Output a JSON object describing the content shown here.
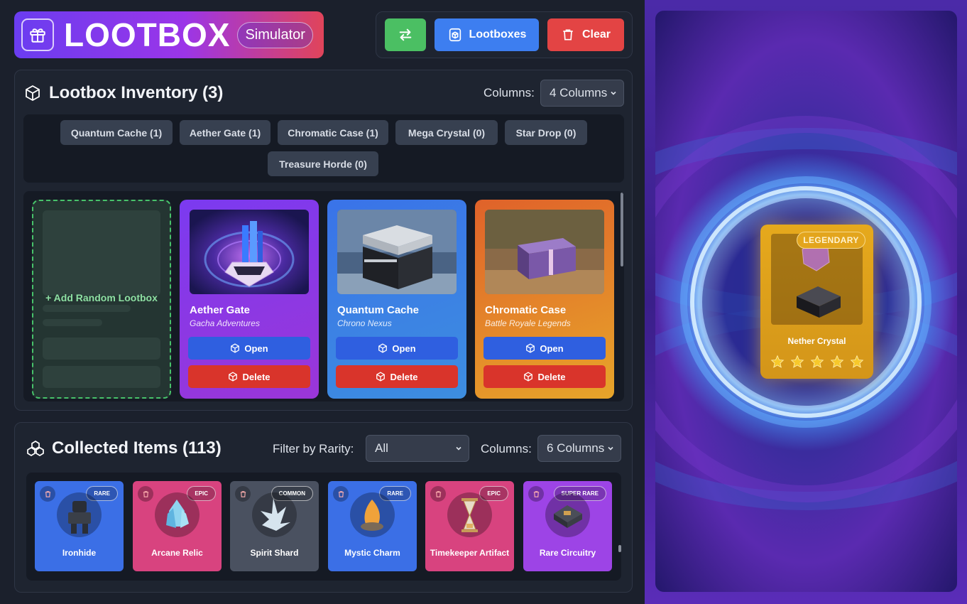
{
  "brand": {
    "title": "LOOTBOX",
    "badge": "Simulator"
  },
  "toolbar": {
    "lootboxes_label": "Lootboxes",
    "clear_label": "Clear"
  },
  "inventory": {
    "title": "Lootbox Inventory (3)",
    "columns_label": "Columns:",
    "columns_value": "4 Columns",
    "chips": [
      "Quantum Cache (1)",
      "Aether Gate (1)",
      "Chromatic Case (1)",
      "Mega Crystal (0)",
      "Star Drop (0)",
      "Treasure Horde (0)"
    ],
    "add_label": "+ Add Random Lootbox",
    "cards": [
      {
        "name": "Aether Gate",
        "game": "Gacha Adventures",
        "open": "Open",
        "delete": "Delete"
      },
      {
        "name": "Quantum Cache",
        "game": "Chrono Nexus",
        "open": "Open",
        "delete": "Delete"
      },
      {
        "name": "Chromatic Case",
        "game": "Battle Royale Legends",
        "open": "Open",
        "delete": "Delete"
      }
    ]
  },
  "collected": {
    "title": "Collected Items (113)",
    "filter_label": "Filter by Rarity:",
    "filter_value": "All",
    "columns_label": "Columns:",
    "columns_value": "6 Columns",
    "items": [
      {
        "name": "Ironhide",
        "rarity": "RARE",
        "color": "#3b6fe6"
      },
      {
        "name": "Arcane Relic",
        "rarity": "EPIC",
        "color": "#d8437f"
      },
      {
        "name": "Spirit Shard",
        "rarity": "COMMON",
        "color": "#4a5160"
      },
      {
        "name": "Mystic Charm",
        "rarity": "RARE",
        "color": "#3b6fe6"
      },
      {
        "name": "Timekeeper Artifact",
        "rarity": "EPIC",
        "color": "#d8437f"
      },
      {
        "name": "Rare Circuitry",
        "rarity": "SUPER RARE",
        "color": "#9d44e6"
      }
    ]
  },
  "reveal": {
    "rarity": "LEGENDARY",
    "name": "Nether Crystal",
    "stars": 5
  }
}
